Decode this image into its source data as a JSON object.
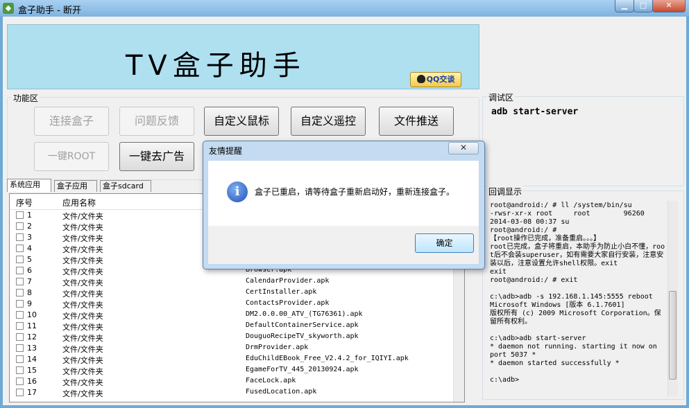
{
  "window": {
    "title": "盒子助手 - 断开"
  },
  "banner": {
    "title": "TV盒子助手",
    "qq_label": "QQ交谈"
  },
  "functions": {
    "legend": "功能区",
    "buttons": {
      "connect": "连接盒子",
      "feedback": "问题反馈",
      "custom_mouse": "自定义鼠标",
      "custom_remote": "自定义遥控",
      "file_push": "文件推送",
      "one_key_root": "一键ROOT",
      "one_key_remove_ads": "一键去广告"
    }
  },
  "tabs": [
    "系统应用",
    "盒子应用",
    "盒子sdcard"
  ],
  "table": {
    "headers": [
      "序号",
      "应用名称"
    ],
    "rows": [
      {
        "no": "1",
        "name": "文件/文件夹",
        "pkg": ""
      },
      {
        "no": "2",
        "name": "文件/文件夹",
        "pkg": ""
      },
      {
        "no": "3",
        "name": "文件/文件夹",
        "pkg": ""
      },
      {
        "no": "4",
        "name": "文件/文件夹",
        "pkg": ""
      },
      {
        "no": "5",
        "name": "文件/文件夹",
        "pkg": ""
      },
      {
        "no": "6",
        "name": "文件/文件夹",
        "pkg": "Browser.apk"
      },
      {
        "no": "7",
        "name": "文件/文件夹",
        "pkg": "CalendarProvider.apk"
      },
      {
        "no": "8",
        "name": "文件/文件夹",
        "pkg": "CertInstaller.apk"
      },
      {
        "no": "9",
        "name": "文件/文件夹",
        "pkg": "ContactsProvider.apk"
      },
      {
        "no": "10",
        "name": "文件/文件夹",
        "pkg": "DM2.0.0.00_ATV_(TG76361).apk"
      },
      {
        "no": "11",
        "name": "文件/文件夹",
        "pkg": "DefaultContainerService.apk"
      },
      {
        "no": "12",
        "name": "文件/文件夹",
        "pkg": "DouguoRecipeTV_skyworth.apk"
      },
      {
        "no": "13",
        "name": "文件/文件夹",
        "pkg": "DrmProvider.apk"
      },
      {
        "no": "14",
        "name": "文件/文件夹",
        "pkg": "EduChildEBook_Free_V2.4.2_for_IQIYI.apk"
      },
      {
        "no": "15",
        "name": "文件/文件夹",
        "pkg": "EgameForTV_445_20130924.apk"
      },
      {
        "no": "16",
        "name": "文件/文件夹",
        "pkg": "FaceLock.apk"
      },
      {
        "no": "17",
        "name": "文件/文件夹",
        "pkg": "FusedLocation.apk"
      }
    ]
  },
  "debug": {
    "legend": "调试区",
    "command": "adb start-server"
  },
  "echo": {
    "legend": "回调显示",
    "text": "root@android:/ # ll /system/bin/su\n-rwsr-xr-x root     root        96260\n2014-03-08 00:37 su\nroot@android:/ #\n【root操作已完成，准备重启。。。】\nroot已完成，盒子将重启，本助手为防止小白不懂，root后不会装superuser，如有需要大家自行安装，注意安装以后，注意设置允许shell权限。exit\nexit\nroot@android:/ # exit\n\nc:\\adb>adb -s 192.168.1.145:5555 reboot\nMicrosoft Windows [版本 6.1.7601]\n版权所有 (c) 2009 Microsoft Corporation。保留所有权利。\n\nc:\\adb>adb start-server\n* daemon not running. starting it now on\nport 5037 *\n* daemon started successfully *\n\nc:\\adb>"
  },
  "dialog": {
    "title": "友情提醒",
    "close_label": "✕",
    "message": "盒子已重启，请等待盒子重新启动好，重新连接盒子。",
    "ok_label": "确定"
  }
}
